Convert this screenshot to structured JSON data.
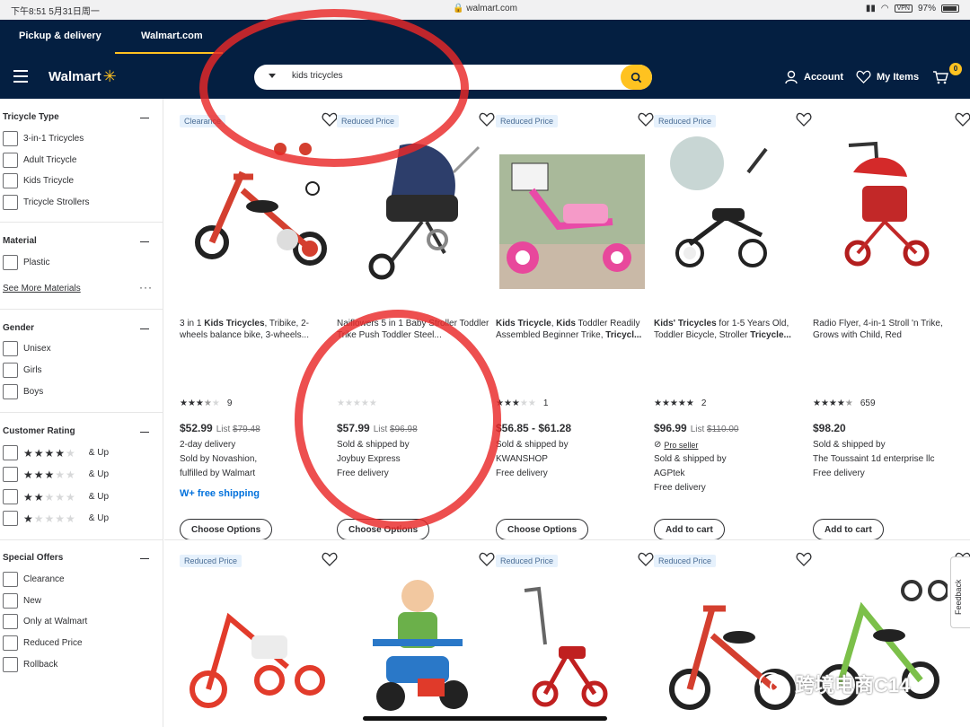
{
  "status_bar": {
    "time": "下午8:51  5月31日周一",
    "url": "walmart.com",
    "vpn": "VPN",
    "battery": "97%"
  },
  "top_tabs": [
    {
      "label": "Pickup & delivery"
    },
    {
      "label": "Walmart.com"
    }
  ],
  "header": {
    "logo": "Walmart",
    "search_value": "kids tricycles",
    "account": "Account",
    "my_items": "My Items",
    "cart_count": "0"
  },
  "sidebar": {
    "tricycle_type": {
      "title": "Tricycle Type",
      "options": [
        "3-in-1 Tricycles",
        "Adult Tricycle",
        "Kids Tricycle",
        "Tricycle Strollers"
      ]
    },
    "material": {
      "title": "Material",
      "options": [
        "Plastic"
      ],
      "see_more": "See More Materials"
    },
    "gender": {
      "title": "Gender",
      "options": [
        "Unisex",
        "Girls",
        "Boys"
      ]
    },
    "customer_rating": {
      "title": "Customer Rating",
      "and_up": "& Up",
      "levels": [
        4,
        3,
        2,
        1
      ]
    },
    "special_offers": {
      "title": "Special Offers",
      "options": [
        "Clearance",
        "New",
        "Only at Walmart",
        "Reduced Price",
        "Rollback"
      ]
    }
  },
  "products": [
    {
      "badge": "Clearance",
      "title_parts": [
        "3 in 1 ",
        "Kids Tricycles",
        ", Tribike, 2-wheels balance bike, 3-wheels..."
      ],
      "stars": 3.5,
      "rating_count": "9",
      "price": "$52.99",
      "list_label": "List",
      "list_price": "$79.48",
      "info": [
        "2-day delivery",
        "Sold by Novashion,",
        "fulfilled by Walmart"
      ],
      "wplus": "free shipping",
      "button": "Choose Options"
    },
    {
      "badge": "Reduced Price",
      "title_parts": [
        "Naiflowers 5 in 1 Baby Stroller Toddler Trike Push Toddler Steel..."
      ],
      "stars": 0,
      "rating_count": "",
      "price": "$57.99",
      "list_label": "List",
      "list_price": "$96.98",
      "info": [
        "Sold & shipped by",
        "Joybuy Express",
        "Free delivery"
      ],
      "button": "Choose Options"
    },
    {
      "badge": "Reduced Price",
      "title_parts": [
        "Kids Tricycle",
        ", ",
        "Kids",
        " Toddler Readily Assembled Beginner Trike, ",
        "Tricycl..."
      ],
      "stars": 3,
      "rating_count": "1",
      "price": "$56.85 - $61.28",
      "info": [
        "Sold & shipped by",
        "KWANSHOP",
        "Free delivery"
      ],
      "button": "Choose Options"
    },
    {
      "badge": "Reduced Price",
      "title_parts": [
        "Kids' Tricycles",
        " for 1-5 Years Old, Toddler Bicycle, Stroller ",
        "Tricycle..."
      ],
      "stars": 5,
      "rating_count": "2",
      "price": "$96.99",
      "list_label": "List",
      "list_price": "$110.00",
      "pro_seller": "Pro seller",
      "info": [
        "Sold & shipped by",
        "AGPtek",
        "Free delivery"
      ],
      "button": "Add to cart"
    },
    {
      "badge": "",
      "title_parts": [
        "Radio Flyer, 4-in-1 Stroll 'n Trike, Grows with Child, Red"
      ],
      "stars": 4.5,
      "rating_count": "659",
      "price": "$98.20",
      "info": [
        "Sold & shipped by",
        "The Toussaint 1d enterprise llc",
        "Free delivery"
      ],
      "button": "Add to cart"
    }
  ],
  "second_row_badges": [
    "Reduced Price",
    "",
    "Reduced Price",
    "Reduced Price",
    ""
  ],
  "feedback": "Feedback",
  "watermark": "跨境电商C14",
  "colors": {
    "navy": "#041f41",
    "yellow": "#ffc220",
    "blue": "#0071dc",
    "annotation_red": "#e92828"
  }
}
